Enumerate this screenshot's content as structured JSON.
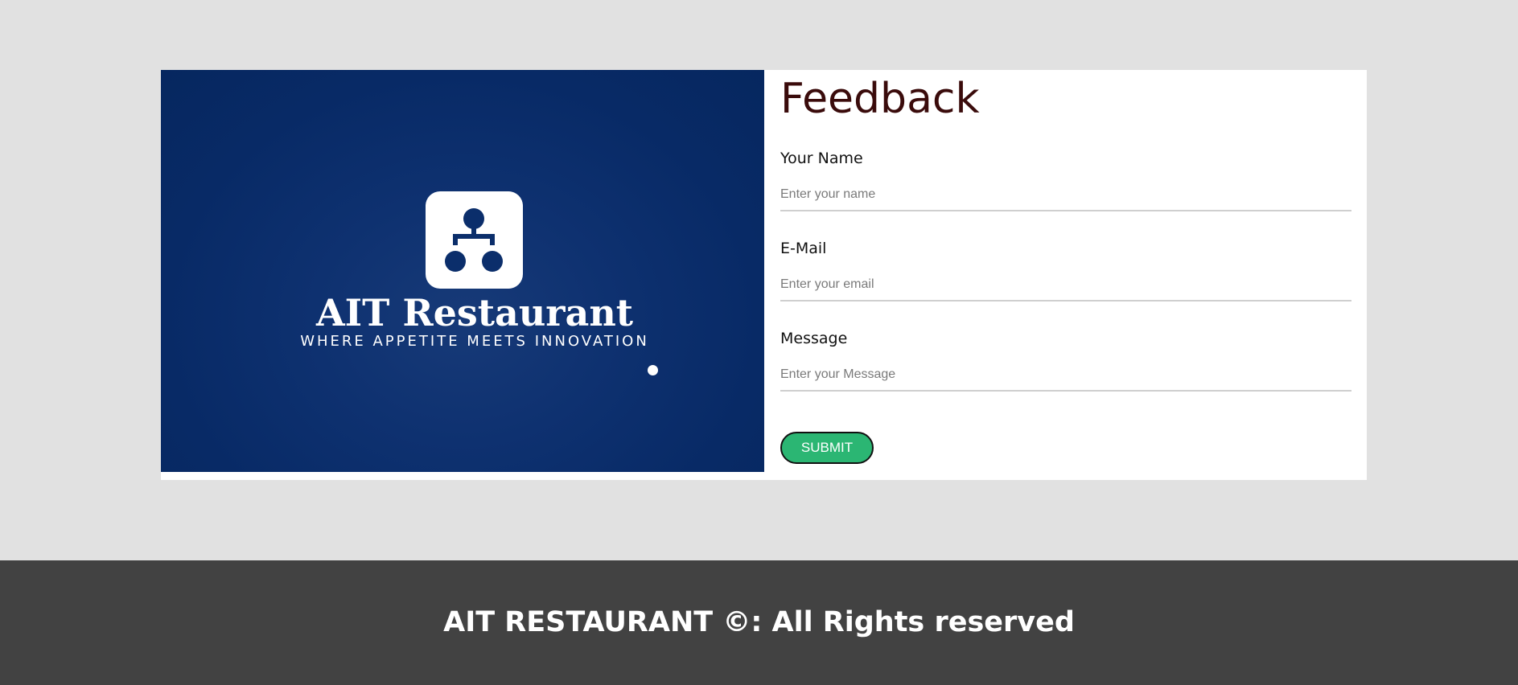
{
  "brand": {
    "name": "AIT Restaurant",
    "tagline": "WHERE APPETITE MEETS INNOVATION",
    "logo_icon": "hierarchy-icon",
    "panel_color": "#082a66"
  },
  "form": {
    "title": "Feedback",
    "name_label": "Your Name",
    "name_placeholder": "Enter your name",
    "name_value": "",
    "email_label": "E-Mail",
    "email_placeholder": "Enter your email",
    "email_value": "",
    "message_label": "Message",
    "message_placeholder": "Enter your Message",
    "message_value": "",
    "submit_label": "SUBMIT",
    "submit_color": "#2bb673",
    "title_color": "#3a0b0b"
  },
  "footer": {
    "text": "AIT RESTAURANT ©: All Rights reserved",
    "background": "#424242"
  }
}
